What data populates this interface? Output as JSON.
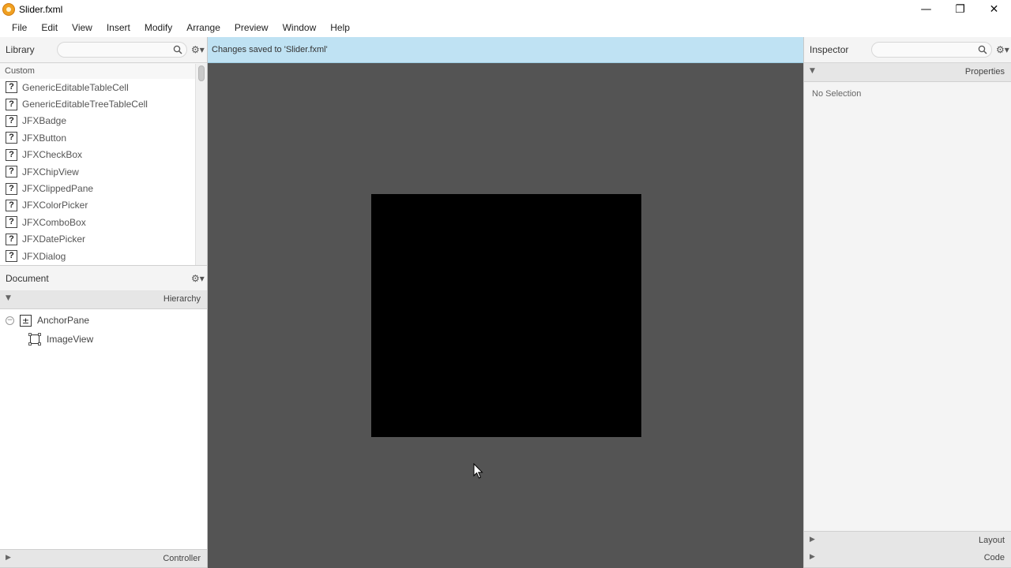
{
  "window": {
    "title": "Slider.fxml",
    "controls": {
      "minimize": "—",
      "restore": "❐",
      "close": "✕"
    }
  },
  "menu": [
    "File",
    "Edit",
    "View",
    "Insert",
    "Modify",
    "Arrange",
    "Preview",
    "Window",
    "Help"
  ],
  "library": {
    "title": "Library",
    "search_value": "",
    "category": "Custom",
    "items": [
      "GenericEditableTableCell",
      "GenericEditableTreeTableCell",
      "JFXBadge",
      "JFXButton",
      "JFXCheckBox",
      "JFXChipView",
      "JFXClippedPane",
      "JFXColorPicker",
      "JFXComboBox",
      "JFXDatePicker",
      "JFXDialog"
    ],
    "item_icon": "?"
  },
  "document": {
    "title": "Document",
    "hierarchy_label": "Hierarchy",
    "tree": [
      {
        "label": "AnchorPane",
        "icon": "anchor-pane-icon",
        "expanded": true
      },
      {
        "label": "ImageView",
        "icon": "image-view-icon"
      }
    ],
    "controller_label": "Controller"
  },
  "status": {
    "message": "Changes saved to 'Slider.fxml'"
  },
  "inspector": {
    "title": "Inspector",
    "search_value": "",
    "properties_label": "Properties",
    "no_selection": "No Selection",
    "layout_label": "Layout",
    "code_label": "Code"
  },
  "colors": {
    "status_bar": "#bfe2f3",
    "canvas": "#545454",
    "image_view": "#000000"
  }
}
